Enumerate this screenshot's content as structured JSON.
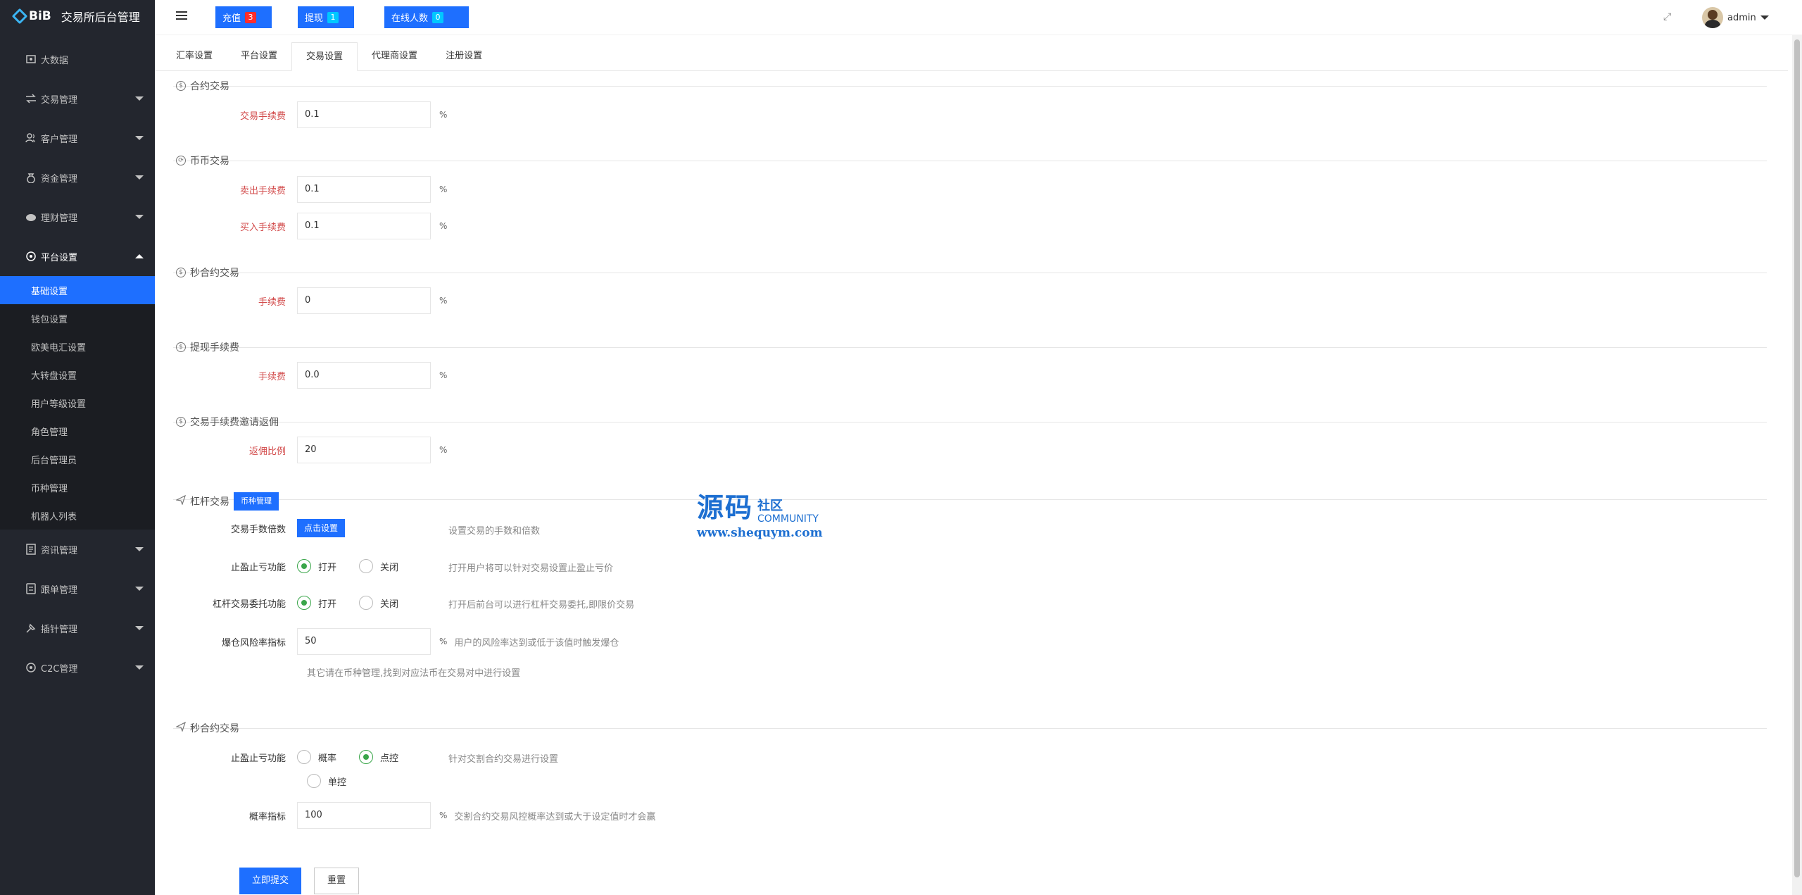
{
  "brand": {
    "logo": "BiB",
    "title": "交易所后台管理"
  },
  "sidebar": {
    "items": [
      {
        "label": "大数据",
        "icon": "dashboard-icon"
      },
      {
        "label": "交易管理",
        "icon": "exchange-icon"
      },
      {
        "label": "客户管理",
        "icon": "users-icon"
      },
      {
        "label": "资金管理",
        "icon": "money-bag-icon"
      },
      {
        "label": "理财管理",
        "icon": "piggy-bank-icon"
      },
      {
        "label": "平台设置",
        "icon": "settings-icon"
      },
      {
        "label": "资讯管理",
        "icon": "news-icon"
      },
      {
        "label": "跟单管理",
        "icon": "follow-order-icon"
      },
      {
        "label": "插针管理",
        "icon": "pin-icon"
      },
      {
        "label": "C2C管理",
        "icon": "c2c-icon"
      }
    ],
    "submenu": [
      "基础设置",
      "钱包设置",
      "欧美电汇设置",
      "大转盘设置",
      "用户等级设置",
      "角色管理",
      "后台管理员",
      "币种管理",
      "机器人列表"
    ]
  },
  "header": {
    "recharge": {
      "label": "充值",
      "count": "3"
    },
    "withdraw": {
      "label": "提现",
      "count": "1"
    },
    "online": {
      "label": "在线人数",
      "count": "0"
    },
    "user": "admin"
  },
  "tabs": [
    "汇率设置",
    "平台设置",
    "交易设置",
    "代理商设置",
    "注册设置"
  ],
  "form": {
    "contract": {
      "title": "合约交易",
      "fee_label": "交易手续费",
      "fee_value": "0.1",
      "unit": "%"
    },
    "spot": {
      "title": "币币交易",
      "sell_label": "卖出手续费",
      "sell_value": "0.1",
      "buy_label": "买入手续费",
      "buy_value": "0.1",
      "unit": "%"
    },
    "second": {
      "title": "秒合约交易",
      "fee_label": "手续费",
      "fee_value": "0",
      "unit": "%"
    },
    "withdraw": {
      "title": "提现手续费",
      "fee_label": "手续费",
      "fee_value": "0.0",
      "unit": "%"
    },
    "invite": {
      "title": "交易手续费邀请返佣",
      "ratio_label": "返佣比例",
      "ratio_value": "20",
      "unit": "%"
    },
    "leverage": {
      "title": "杠杆交易",
      "coin_btn": "币种管理",
      "hands_label": "交易手数倍数",
      "hands_btn": "点击设置",
      "hands_hint": "设置交易的手数和倍数",
      "tpsl_label": "止盈止亏功能",
      "open": "打开",
      "close": "关闭",
      "tpsl_hint": "打开用户将可以针对交易设置止盈止亏价",
      "entrust_label": "杠杆交易委托功能",
      "entrust_hint": "打开后前台可以进行杠杆交易委托,即限价交易",
      "risk_label": "爆仓风险率指标",
      "risk_value": "50",
      "unit": "%",
      "risk_hint": "用户的风险率达到或低于该值时触发爆仓",
      "note": "其它请在币种管理,找到对应法币在交易对中进行设置"
    },
    "second2": {
      "title": "秒合约交易",
      "tpsl_label": "止盈止亏功能",
      "opt1": "概率",
      "opt2": "点控",
      "opt3": "单控",
      "tpsl_hint": "针对交割合约交易进行设置",
      "prob_label": "概率指标",
      "prob_value": "100",
      "unit": "%",
      "prob_hint": "交割合约交易风控概率达到或大于设定值时才会赢"
    }
  },
  "actions": {
    "submit": "立即提交",
    "reset": "重置"
  },
  "watermark": {
    "cn": "源码",
    "side": "社区",
    "en": "COMMUNITY",
    "url": "www.shequym.com"
  }
}
